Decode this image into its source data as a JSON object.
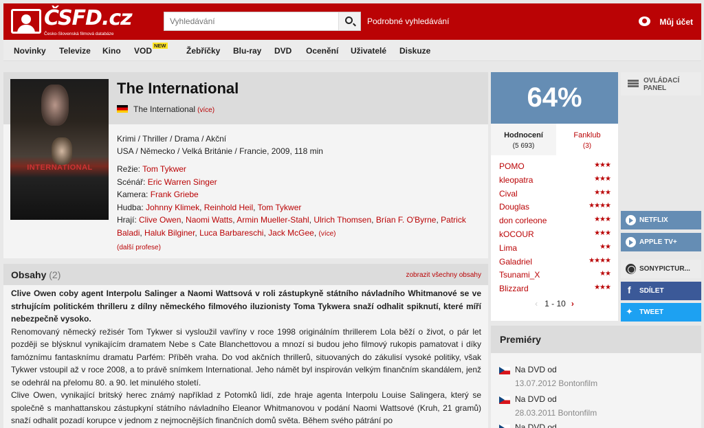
{
  "header": {
    "logo_text": "ČSFD.cz",
    "logo_subtitle": "Česko-Slovenská filmová databáze",
    "search_placeholder": "Vyhledávání",
    "advanced_search": "Podrobné vyhledávání",
    "account": "Můj účet"
  },
  "nav": {
    "items": [
      "Novinky",
      "Televize",
      "Kino",
      "VOD",
      "Žebříčky",
      "Blu-ray",
      "DVD",
      "Ocenění",
      "Uživatelé",
      "Diskuze"
    ],
    "new_badge": "NEW"
  },
  "film": {
    "title": "The International",
    "original_title": "The International",
    "original_more": "(více)",
    "poster_text": "INTERNATIONAL",
    "genres": "Krimi / Thriller / Drama / Akční",
    "origin": "USA / Německo / Velká Británie / Francie, 2009, 118 min",
    "director_label": "Režie:",
    "director": "Tom Tykwer",
    "writer_label": "Scénář:",
    "writer": "Eric Warren Singer",
    "camera_label": "Kamera:",
    "camera": "Frank Griebe",
    "music_label": "Hudba:",
    "music": [
      "Johnny Klimek",
      "Reinhold Heil",
      "Tom Tykwer"
    ],
    "cast_label": "Hrají:",
    "cast": [
      "Clive Owen",
      "Naomi Watts",
      "Armin Mueller-Stahl",
      "Ulrich Thomsen",
      "Brían F. O'Byrne",
      "Patrick Baladi",
      "Haluk Bilginer",
      "Luca Barbareschi",
      "Jack McGee"
    ],
    "cast_more": "(více)",
    "more_professions": "(další profese)"
  },
  "synopsis": {
    "title": "Obsahy",
    "count": "(2)",
    "show_all": "zobrazit všechny obsahy",
    "bold_intro": "Clive Owen coby agent Interpolu Salinger a Naomi Wattsová v roli zástupkyně státního návladního Whitmanové se ve strhujícím politickém thrilleru z dílny německého filmového iluzionisty Toma Tykwera snaží odhalit spiknutí, které míří nebezpečně vysoko.",
    "paragraph_1": "Renomovaný německý režisér Tom Tykwer si vysloužil vavříny v roce 1998 originálním thrillerem Lola běží o život, o pár let později se blýsknul vynikajícím dramatem Nebe s Cate Blanchettovou a mnozí si budou jeho filmový rukopis pamatovat i díky famóznímu fantasknímu dramatu Parfém: Příběh vraha. Do vod akčních thrillerů, situovaných do zákulisí vysoké politiky, však Tykwer vstoupil až v roce 2008, a to právě snímkem International. Jeho námět byl inspirován velkým finančním skandálem, jenž se odehrál na přelomu 80. a 90. let minulého století.",
    "paragraph_2": "Clive Owen, vynikající britský herec známý například z Potomků lidí, zde hraje agenta Interpolu Louise Salingera, který se společně s manhattanskou zástupkyní státního návladního Eleanor Whitmanovou v podání Naomi Wattsové (Kruh, 21 gramů) snaží odhalit pozadí korupce v jednom z nejmocnějších finančních domů světa. Během svého pátrání po"
  },
  "rating": {
    "percent": "64%",
    "tab_ratings": "Hodnocení",
    "tab_ratings_count": "(5 693)",
    "tab_fanclub": "Fanklub",
    "tab_fanclub_count": "(3)",
    "users": [
      {
        "name": "POMO",
        "stars": "★★★"
      },
      {
        "name": "kleopatra",
        "stars": "★★★"
      },
      {
        "name": "Cival",
        "stars": "★★★"
      },
      {
        "name": "Douglas",
        "stars": "★★★★"
      },
      {
        "name": "don corleone",
        "stars": "★★★"
      },
      {
        "name": "kOCOUR",
        "stars": "★★★"
      },
      {
        "name": "Lima",
        "stars": "★★"
      },
      {
        "name": "Galadriel",
        "stars": "★★★★"
      },
      {
        "name": "Tsunami_X",
        "stars": "★★"
      },
      {
        "name": "Blizzard",
        "stars": "★★★"
      }
    ],
    "pager": "1 - 10"
  },
  "side": {
    "control_panel": "OVLÁDACÍ PANEL",
    "netflix": "NETFLIX",
    "appletv": "APPLE TV+",
    "sony": "SONYPICTUR...",
    "share": "SDÍLET",
    "tweet": "TWEET"
  },
  "premieres": {
    "title": "Premiéry",
    "items": [
      {
        "label": "Na DVD od",
        "date": "13.07.2012 Bontonfilm"
      },
      {
        "label": "Na DVD od",
        "date": "28.03.2011 Bontonfilm"
      },
      {
        "label": "Na DVD od",
        "date": ""
      }
    ]
  },
  "colors": {
    "brand_red": "#ba0305",
    "rating_blue": "#658db4",
    "facebook": "#3b5998",
    "twitter": "#1da1f2"
  }
}
